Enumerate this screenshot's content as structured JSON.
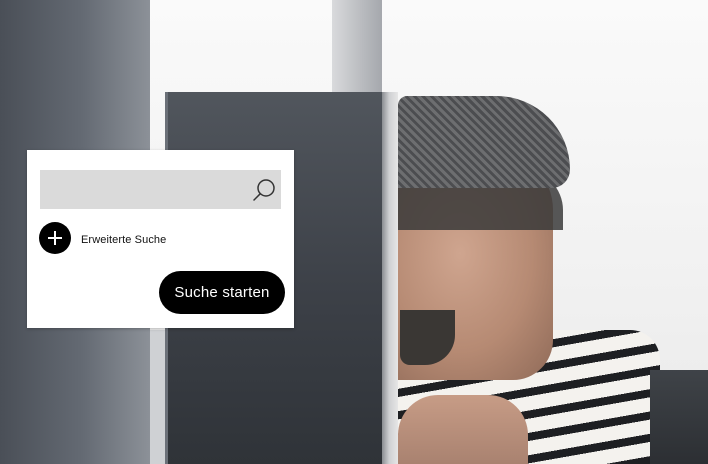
{
  "search": {
    "value": "",
    "placeholder": ""
  },
  "advanced_search": {
    "label": "Erweiterte Suche",
    "icon": "plus-icon"
  },
  "actions": {
    "submit_label": "Suche starten"
  },
  "icons": {
    "search": "search-icon",
    "advanced": "plus-icon"
  },
  "colors": {
    "card_background": "#ffffff",
    "input_background": "#dadada",
    "button_background": "#000000",
    "button_text": "#ffffff"
  }
}
